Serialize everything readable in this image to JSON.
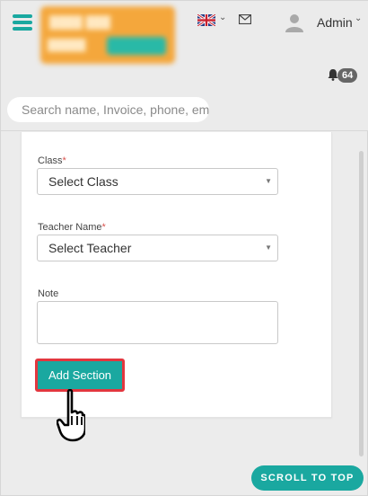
{
  "header": {
    "user_name": "Admin",
    "notification_count": "64",
    "search_placeholder": "Search name, Invoice, phone, ema",
    "icons": [
      "menu-icon",
      "uk-flag-icon",
      "mail-icon",
      "user-icon",
      "bell-icon"
    ]
  },
  "form": {
    "class_label": "Class",
    "class_value": "Select Class",
    "teacher_label": "Teacher Name",
    "teacher_value": "Select Teacher",
    "note_label": "Note",
    "required_mark": "*",
    "submit_label": "Add Section"
  },
  "footer": {
    "scroll_top_label": "SCROLL TO TOP"
  },
  "colors": {
    "accent": "#1aa8a0",
    "highlight_border": "#e3373f",
    "required": "#d9534f"
  }
}
